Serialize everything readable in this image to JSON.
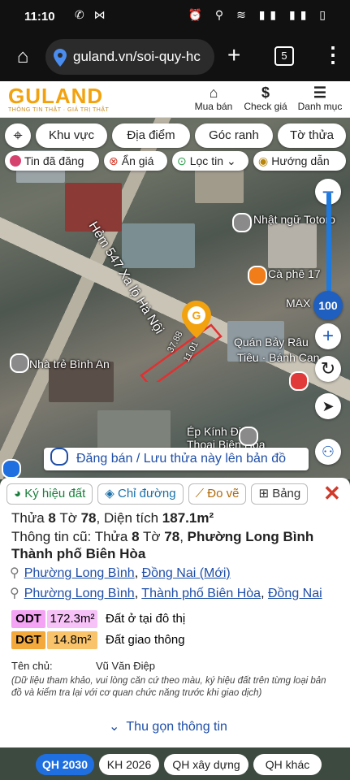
{
  "status_bar": {
    "time": "11:10",
    "left_icons": "✆ ⋈",
    "right_icons": "⏰ ⚲ ≋ ▮▮ ▮▮ ▯"
  },
  "browser": {
    "url": "guland.vn/soi-quy-hc",
    "tab_count": "5"
  },
  "site": {
    "logo_text": "GULAND",
    "logo_tagline": "THÔNG TIN THẬT · GIÁ TRỊ THẬT",
    "nav": [
      {
        "label": "Mua bán",
        "icon": "building-icon"
      },
      {
        "label": "Check giá",
        "icon": "dollar-icon"
      },
      {
        "label": "Danh mục",
        "icon": "menu-icon"
      }
    ]
  },
  "map_toolbar": {
    "row1": [
      "Khu vực",
      "Địa điểm",
      "Góc ranh",
      "Tờ thửa"
    ],
    "row2": [
      "Tin đã đăng",
      "Ẩn giá",
      "Lọc tin",
      "Hướng dẫn"
    ]
  },
  "map": {
    "labels": [
      "Hẻm 547 Xa lộ Hà Nội",
      "Nhật ngữ Totoro",
      "Cà phê 17",
      "MAX",
      "Quán Bảy Râu",
      "Tiêu · Bánh Can",
      "Nhà trẻ Bình An",
      "Ép Kính Điện",
      "Thoại Biên Hòa"
    ],
    "edge_lengths": [
      "37.88",
      "11.01"
    ],
    "zoom_level": "100",
    "zoom_fraction": 0.0,
    "post_button": "Đăng bán / Lưu thửa này lên bản đồ"
  },
  "info_panel": {
    "tabs": [
      "Ký hiệu đất",
      "Chỉ đường",
      "Đo vẽ",
      "Bảng"
    ],
    "parcel": {
      "prefix": "Thửa",
      "parcel_no": "8",
      "sheet_label": "Tờ",
      "sheet_no": "78",
      "area_label": "Diện tích",
      "area": "187.1m²"
    },
    "old_info": {
      "label": "Thông tin cũ: Thửa",
      "parcel_no": "8",
      "sheet_label": "Tờ",
      "sheet_no": "78",
      "ward": "Phường Long Bình",
      "city": "Thành phố Biên Hòa"
    },
    "addresses": [
      [
        "Phường Long Bình",
        "Đồng Nai (Mới)"
      ],
      [
        "Phường Long Bình",
        "Thành phố Biên Hòa",
        "Đồng Nai"
      ]
    ],
    "land_use": [
      {
        "code": "ODT",
        "area": "172.3m²",
        "desc": "Đất ở tại đô thị",
        "color": "#f5a3f5",
        "area_color": "#f7c2f7"
      },
      {
        "code": "DGT",
        "area": "14.8m²",
        "desc": "Đất giao thông",
        "color": "#f3a93b",
        "area_color": "#f8c36b"
      }
    ],
    "owner_label": "Tên chủ:",
    "owner_name": "Vũ Văn Điệp",
    "disclaimer": "(Dữ liệu tham khảo, vui lòng căn cứ theo màu, ký hiệu đất trên từng loại bản đồ và kiểm tra lại với cơ quan chức năng trước khi giao dịch)",
    "collapse": "Thu gọn thông tin"
  },
  "bottom_tabs": [
    "QH 2030",
    "KH 2026",
    "QH xây dựng",
    "QH khác"
  ],
  "colors": {
    "brand": "#f2a20e",
    "link": "#1f4ea8",
    "active_tab": "#1f6fe0",
    "parcel_outline": "#e23030"
  }
}
